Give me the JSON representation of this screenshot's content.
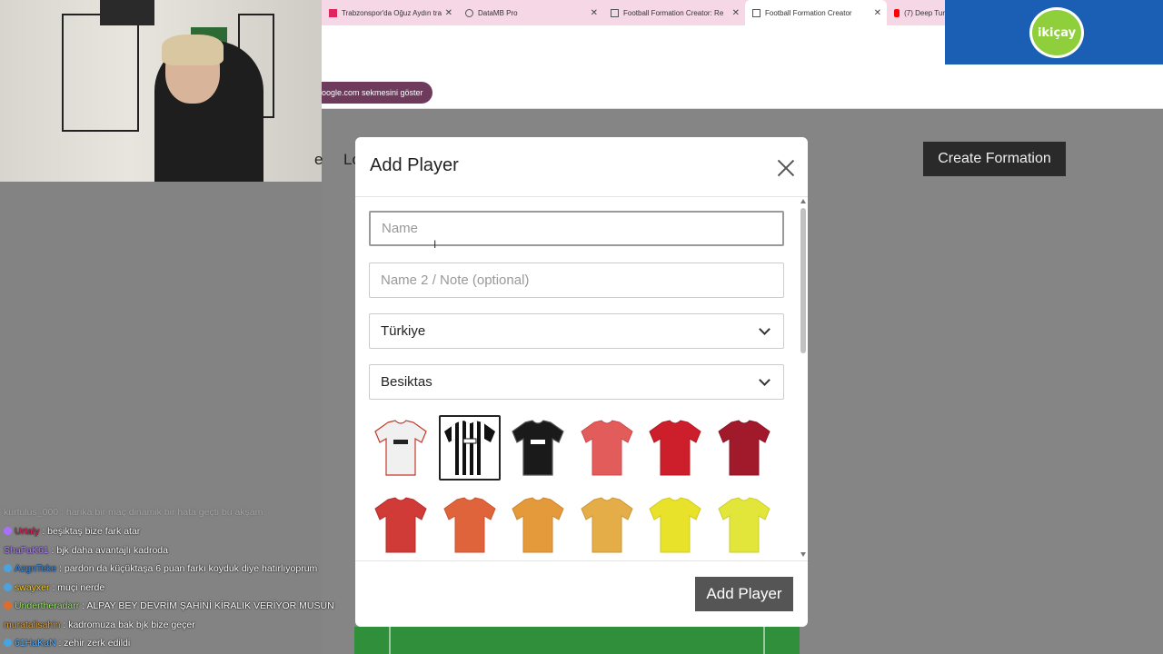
{
  "browser": {
    "tabs": [
      {
        "title": "Trabzonspor'da Oğuz Aydın tra",
        "color": "#e0245e"
      },
      {
        "title": "DataMB Pro",
        "color": "#555555"
      },
      {
        "title": "Football Formation Creator: Re",
        "color": "#555555"
      },
      {
        "title": "Football Formation Creator",
        "color": "#555555",
        "active": true
      },
      {
        "title": "(7) Deep Tur",
        "color": "#ff0000"
      }
    ],
    "close_glyph": "✕",
    "bookmark_chip": "oogle.com sekmesini göster"
  },
  "page": {
    "nav_fragment_1": "e",
    "nav_fragment_2": "Lo",
    "create_formation": "Create Formation"
  },
  "overlay": {
    "sponsor_logo": "ikiçay"
  },
  "chat": {
    "faded_line": "kurtulus_000 : harika bir maç dinamik bir hata geçti bu akşam",
    "messages": [
      {
        "user": "Urtaly",
        "text": ": beşiktaş bize fark atar",
        "user_color": "#e0245e",
        "badge_color": "#a970ff"
      },
      {
        "user": "ShaFaK61",
        "text": ": bjk daha avantajlı kadroda",
        "user_color": "#b38cff",
        "badge_color": ""
      },
      {
        "user": "AzgnTeke",
        "text": ": pardon da küçüktaşa 6 puan farkı koyduk diye hatırlıyoprum",
        "user_color": "#3a8ee6",
        "badge_color": "#4aa3df"
      },
      {
        "user": "swayxer",
        "text": ": muçi nerde",
        "user_color": "#ffd21f",
        "badge_color": "#4aa3df"
      },
      {
        "user": "Undertheradarr",
        "text": ": ALPAY BEY DEVRİM ŞAHİNİ KİRALIK VERİYOR MUSUN",
        "user_color": "#9fe870",
        "badge_color": "#e06c2b"
      },
      {
        "user": "muratalisahin",
        "text": ": kadromuza bak bjk bize geçer",
        "user_color": "#e8a33a",
        "badge_color": ""
      },
      {
        "user": "61HaKaN",
        "text": ": zehir zerk edildi",
        "user_color": "#5fb4ff",
        "badge_color": "#4aa3df"
      }
    ]
  },
  "modal": {
    "title": "Add Player",
    "name_placeholder": "Name",
    "name2_placeholder": "Name 2 / Note (optional)",
    "country_value": "Türkiye",
    "team_value": "Besiktas",
    "jerseys": [
      {
        "name": "white-jersey",
        "body": "#f0f0f0",
        "accent": "#c0392b",
        "pattern": "plain-sponsor",
        "selected": false
      },
      {
        "name": "black-white-stripe-jersey",
        "body": "#111111",
        "accent": "#ffffff",
        "pattern": "stripes",
        "selected": true
      },
      {
        "name": "black-jersey",
        "body": "#1a1a1a",
        "accent": "#555555",
        "pattern": "plain-sponsor",
        "selected": false
      },
      {
        "name": "light-red-jersey",
        "body": "#e25c5c",
        "accent": "#d04848",
        "pattern": "plain",
        "selected": false
      },
      {
        "name": "red-jersey",
        "body": "#cc1f2b",
        "accent": "#b01820",
        "pattern": "plain",
        "selected": false
      },
      {
        "name": "dark-red-jersey",
        "body": "#a11a2c",
        "accent": "#8c1525",
        "pattern": "plain",
        "selected": false
      },
      {
        "name": "red-jersey-2",
        "body": "#d03a37",
        "accent": "#b72e2c",
        "pattern": "plain",
        "selected": false
      },
      {
        "name": "orange-red-jersey",
        "body": "#e0643b",
        "accent": "#c8552f",
        "pattern": "plain",
        "selected": false
      },
      {
        "name": "orange-jersey",
        "body": "#e49a3b",
        "accent": "#cd862c",
        "pattern": "plain",
        "selected": false
      },
      {
        "name": "gold-jersey",
        "body": "#e4ad48",
        "accent": "#cd9838",
        "pattern": "plain",
        "selected": false
      },
      {
        "name": "yellow-jersey",
        "body": "#e8e22a",
        "accent": "#d0cb1e",
        "pattern": "plain",
        "selected": false
      },
      {
        "name": "lime-yellow-jersey",
        "body": "#e3e63a",
        "accent": "#cccf2c",
        "pattern": "plain",
        "selected": false
      }
    ],
    "submit_label": "Add Player"
  }
}
